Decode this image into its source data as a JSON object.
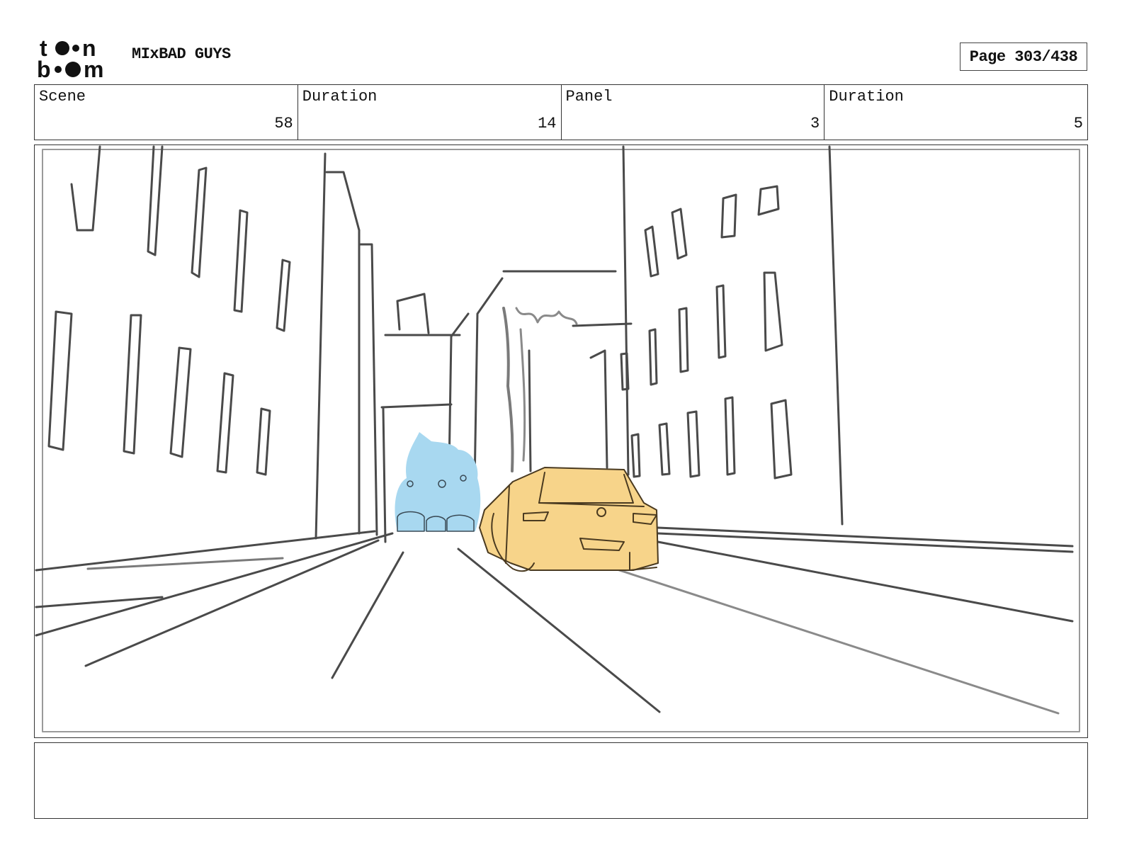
{
  "header": {
    "logo_text": "toon boom",
    "project_title": "MIxBAD GUYS",
    "page_label": "Page 303/438"
  },
  "info_bar": {
    "scene": {
      "label": "Scene",
      "value": "58"
    },
    "scene_duration": {
      "label": "Duration",
      "value": "14"
    },
    "panel": {
      "label": "Panel",
      "value": "3"
    },
    "panel_duration": {
      "label": "Duration",
      "value": "5"
    }
  },
  "panel": {
    "description": "",
    "colors": {
      "sketch_line": "#4a4a4a",
      "blue_cars": "#a8d8f0",
      "yellow_car": "#f7d48a"
    }
  },
  "notes": {
    "text": ""
  }
}
